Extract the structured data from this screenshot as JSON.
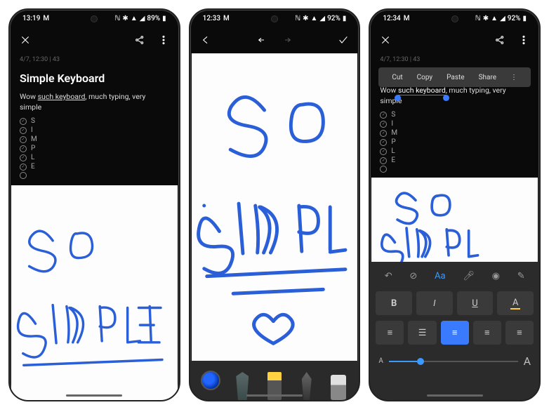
{
  "phone1": {
    "status": {
      "time": "13:19",
      "battery": "89%"
    },
    "meta": "4/7, 12:30 | 43",
    "title": "Simple Keyboard",
    "body_pre": "Wow ",
    "body_under": "such keyboard",
    "body_post": ", much typing, very simple",
    "checks": [
      "S",
      "I",
      "M",
      "P",
      "L",
      "E",
      ""
    ],
    "handwriting": {
      "line1": "So",
      "line2": "SIMPLE"
    }
  },
  "phone2": {
    "status": {
      "time": "12:33",
      "battery": "92%"
    },
    "handwriting": {
      "line1": "So",
      "line2": "SIMPLE"
    },
    "tools": [
      "color",
      "pencil",
      "highlighter",
      "pen",
      "eraser"
    ]
  },
  "phone3": {
    "status": {
      "time": "12:34",
      "battery": "92%"
    },
    "meta": "4/7, 12:30 | 43",
    "ctx": {
      "cut": "Cut",
      "copy": "Copy",
      "paste": "Paste",
      "share": "Share"
    },
    "body_pre": "Wow ",
    "body_sel": "such keyboard",
    "body_post": ", much typing, very simple",
    "checks": [
      "S",
      "I",
      "M",
      "P",
      "L",
      "E",
      ""
    ],
    "handwriting": {
      "line1": "So",
      "line2": "SIMPLE"
    },
    "fmt": {
      "tabs": [
        "undo",
        "check",
        "text",
        "mic",
        "camera",
        "draw"
      ],
      "row1": [
        "B",
        "I",
        "U",
        "A"
      ],
      "row2": [
        "list-num",
        "list-bul",
        "align-l",
        "align-c",
        "align-r"
      ],
      "size_small": "A",
      "size_large": "A"
    }
  }
}
